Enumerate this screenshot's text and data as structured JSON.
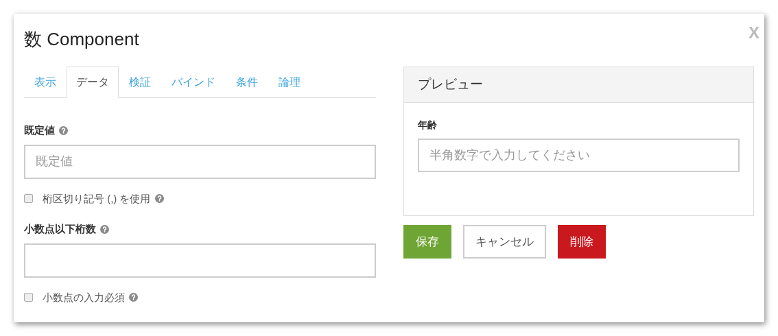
{
  "dialog": {
    "title": "数 Component",
    "close": "X"
  },
  "tabs": [
    {
      "label": "表示",
      "selected": false
    },
    {
      "label": "データ",
      "selected": true
    },
    {
      "label": "検証",
      "selected": false
    },
    {
      "label": "バインド",
      "selected": false
    },
    {
      "label": "条件",
      "selected": false
    },
    {
      "label": "論理",
      "selected": false
    }
  ],
  "form": [
    {
      "kind": "field",
      "label": "既定値",
      "help": true,
      "placeholder": "既定値"
    },
    {
      "kind": "checkbox",
      "label": "桁区切り記号 (,) を使用",
      "help": true,
      "checked": false
    },
    {
      "kind": "field",
      "label": "小数点以下桁数",
      "help": true
    },
    {
      "kind": "checkbox",
      "label": "小数点の入力必須",
      "help": true,
      "checked": false
    }
  ],
  "preview": {
    "title": "プレビュー",
    "label": "年齢",
    "placeholder": "半角数字で入力してください"
  },
  "buttons": [
    {
      "label": "保存",
      "kind": "save"
    },
    {
      "label": "キャンセル",
      "kind": "cancel"
    },
    {
      "label": "削除",
      "kind": "delete"
    }
  ]
}
